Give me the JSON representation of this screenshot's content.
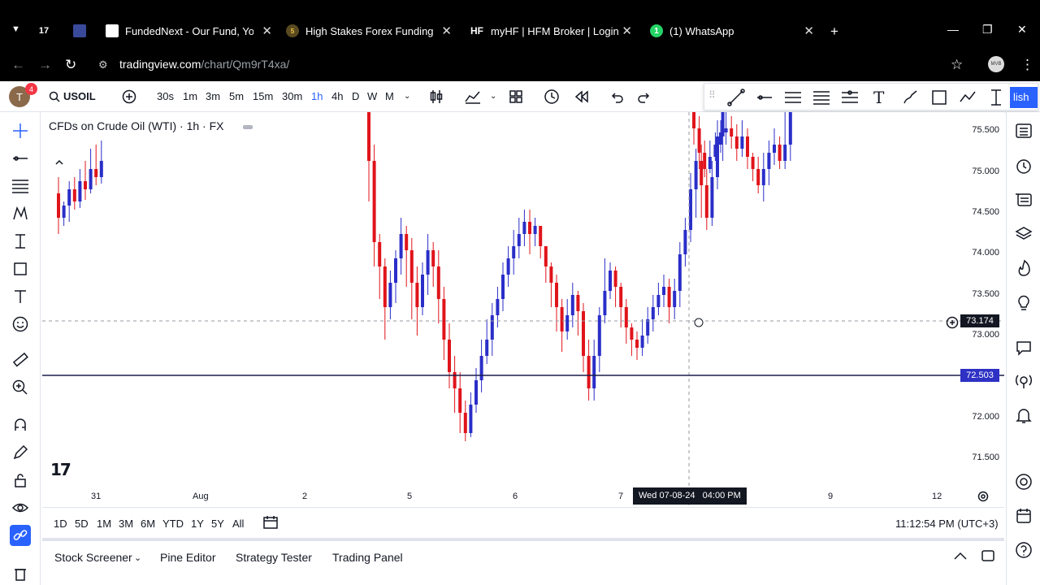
{
  "browser": {
    "tabs": [
      {
        "icon": "tradingview-icon",
        "title": ""
      },
      {
        "icon": "chart-icon",
        "title": ""
      },
      {
        "icon": "fundednext-icon",
        "title": "FundedNext - Our Fund, Your P"
      },
      {
        "icon": "5ers-icon",
        "title": "High Stakes Forex Funding Prog"
      },
      {
        "icon": "hf-icon",
        "favtext": "HF",
        "title": "myHF | HFM Broker | Login"
      },
      {
        "icon": "whatsapp-icon",
        "favtext": "1",
        "title": "(1) WhatsApp"
      }
    ],
    "url_host": "tradingview.com",
    "url_path": "/chart/Qm9rT4xa/"
  },
  "toolbar": {
    "avatar_initial": "T",
    "notification_count": "4",
    "symbol": "USOIL",
    "intervals": [
      "30s",
      "1m",
      "3m",
      "5m",
      "15m",
      "30m",
      "1h",
      "4h",
      "D",
      "W",
      "M"
    ],
    "active_interval": "1h",
    "publish_label": "lish"
  },
  "chart": {
    "legend": "CFDs on Crude Oil (WTI) · 1h · FX",
    "price_labels": [
      "75.500",
      "75.000",
      "74.500",
      "74.000",
      "73.500",
      "73.000",
      "72.000",
      "71.500"
    ],
    "crosshair_price": "73.174",
    "last_price": "72.503",
    "time_labels": [
      "31",
      "Aug",
      "2",
      "5",
      "6",
      "7",
      "9",
      "12"
    ],
    "crosshair_time": "Wed 07-08-24   04:00 PM",
    "colors": {
      "up": "#2a2ec8",
      "down": "#e0141b",
      "last_price": "#2e31c4"
    }
  },
  "chart_data": {
    "type": "candlestick",
    "symbol": "USOIL",
    "title": "CFDs on Crude Oil (WTI) · 1h · FX",
    "ylim": [
      71.3,
      75.7
    ],
    "last_price": 72.503,
    "crosshair_price": 73.174
  },
  "range": {
    "buttons": [
      "1D",
      "5D",
      "1M",
      "3M",
      "6M",
      "YTD",
      "1Y",
      "5Y",
      "All"
    ],
    "clock": "11:12:54 PM (UTC+3)"
  },
  "bottom": {
    "tabs": [
      "Stock Screener",
      "Pine Editor",
      "Strategy Tester",
      "Trading Panel"
    ]
  }
}
